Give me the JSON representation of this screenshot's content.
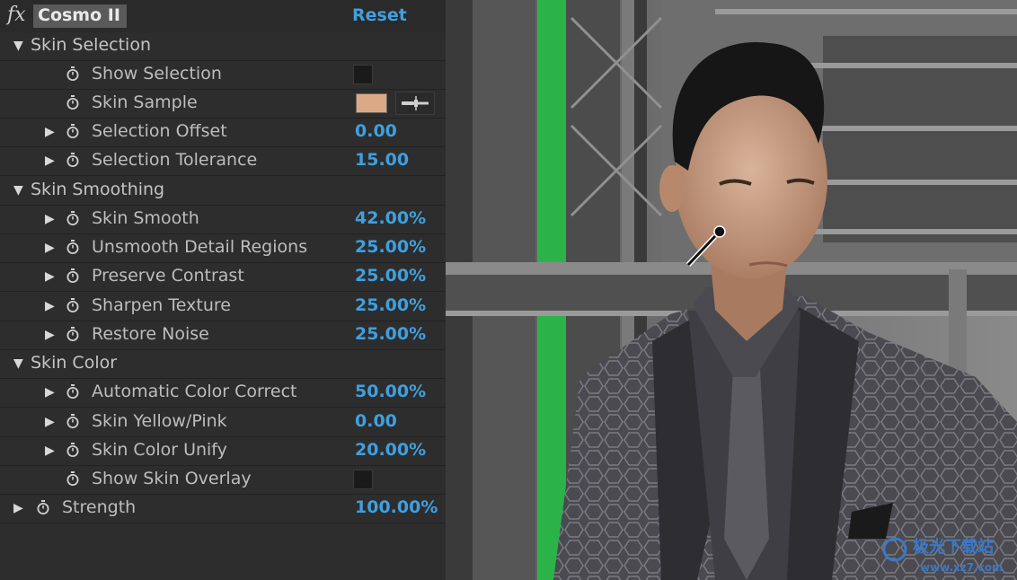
{
  "effect": {
    "fx_label": "fx",
    "name": "Cosmo II",
    "reset_label": "Reset"
  },
  "groups": {
    "skin_selection": "Skin Selection",
    "skin_smoothing": "Skin Smoothing",
    "skin_color": "Skin Color"
  },
  "rows": {
    "show_selection": {
      "label": "Show Selection"
    },
    "skin_sample": {
      "label": "Skin Sample",
      "color": "#dba985"
    },
    "selection_offset": {
      "label": "Selection Offset",
      "value": "0.00"
    },
    "selection_tolerance": {
      "label": "Selection Tolerance",
      "value": "15.00"
    },
    "skin_smooth": {
      "label": "Skin Smooth",
      "value": "42.00%"
    },
    "unsmooth_detail": {
      "label": "Unsmooth Detail Regions",
      "value": "25.00%"
    },
    "preserve_contrast": {
      "label": "Preserve Contrast",
      "value": "25.00%"
    },
    "sharpen_texture": {
      "label": "Sharpen Texture",
      "value": "25.00%"
    },
    "restore_noise": {
      "label": "Restore Noise",
      "value": "25.00%"
    },
    "auto_color": {
      "label": "Automatic Color Correct",
      "value": "50.00%"
    },
    "yellow_pink": {
      "label": "Skin Yellow/Pink",
      "value": "0.00"
    },
    "color_unify": {
      "label": "Skin Color Unify",
      "value": "20.00%"
    },
    "show_overlay": {
      "label": "Show Skin Overlay"
    },
    "strength": {
      "label": "Strength",
      "value": "100.00%"
    }
  },
  "watermark": {
    "text": "极光下载站",
    "url": "www.xz7.com"
  },
  "colors": {
    "accent": "#3fa0df",
    "panel_bg": "#2d2d2d",
    "header_bg": "#5a5a5a"
  },
  "icons": [
    "stopwatch-icon",
    "expand-triangle-icon",
    "collapse-triangle-icon",
    "eyedropper-icon"
  ]
}
